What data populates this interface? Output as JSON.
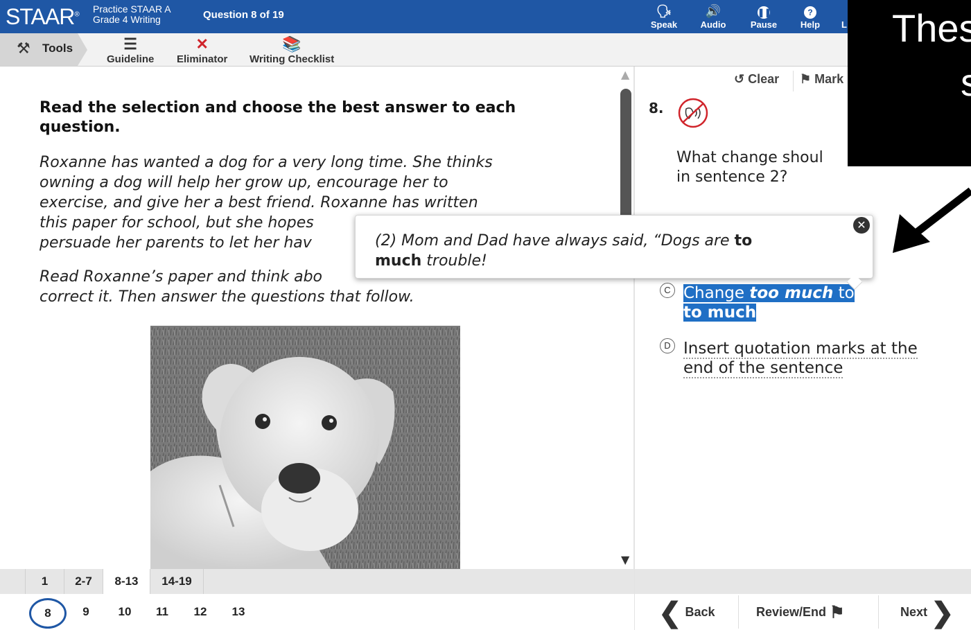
{
  "header": {
    "logo": "STAAR",
    "logo_mark": "®",
    "test_name": "Practice STAAR A",
    "test_grade": "Grade 4 Writing",
    "question_counter": "Question 8 of 19",
    "buttons": [
      {
        "label": "Speak",
        "icon": "speak-icon"
      },
      {
        "label": "Audio",
        "icon": "audio-icon"
      },
      {
        "label": "Pause",
        "icon": "pause-icon"
      },
      {
        "label": "Help",
        "icon": "help-icon"
      },
      {
        "label": "L",
        "icon": "clipped-icon"
      }
    ]
  },
  "toolbar": {
    "tools_label": "Tools",
    "items": [
      {
        "label": "Guideline",
        "icon": "guideline-icon"
      },
      {
        "label": "Eliminator",
        "icon": "eliminator-x-icon"
      },
      {
        "label": "Writing Checklist",
        "icon": "writing-checklist-icon"
      }
    ]
  },
  "passage": {
    "instruction": "Read the selection and choose the best answer to each question.",
    "paragraph1_lines": [
      "Roxanne has wanted a dog for a very long time. She thinks",
      "owning a dog will help her grow up, encourage her to",
      "exercise, and give her a best friend. Roxanne has written",
      "this paper for school, but she hopes",
      "persuade her parents to let her hav"
    ],
    "paragraph2_lines": [
      "Read Roxanne’s paper and think abo",
      "correct it. Then answer the questions that follow."
    ],
    "image": "labrador-puppy-photo"
  },
  "question": {
    "clear_label": "Clear",
    "mark_label": "Mark",
    "number": "8.",
    "stem_lines": [
      "What change shoul",
      "in sentence 2?"
    ],
    "options": [
      {
        "letter": "C",
        "lines_plain": [
          "Change ",
          " to"
        ],
        "emph1": "too much",
        "line2": "to much"
      },
      {
        "letter": "D",
        "lines": [
          "Insert quotation marks at the",
          "end of the sentence"
        ]
      }
    ]
  },
  "popup": {
    "text_a": "(2) Mom and Dad have always said, “Dogs are ",
    "text_bold1": "to",
    "text_bold2": "much",
    "text_b": " trouble!",
    "close_icon": "close-circle-icon"
  },
  "overlay": {
    "line1": "Thes",
    "line2": "s"
  },
  "navigation": {
    "groups": [
      "1",
      "2-7",
      "8-13",
      "14-19"
    ],
    "active_group": "8-13",
    "questions": [
      "8",
      "9",
      "10",
      "11",
      "12",
      "13"
    ],
    "current_question": "8",
    "back_label": "Back",
    "review_label": "Review/End",
    "next_label": "Next"
  },
  "colors": {
    "header_blue": "#1f57a5",
    "highlight_blue": "#1f6fc5"
  }
}
